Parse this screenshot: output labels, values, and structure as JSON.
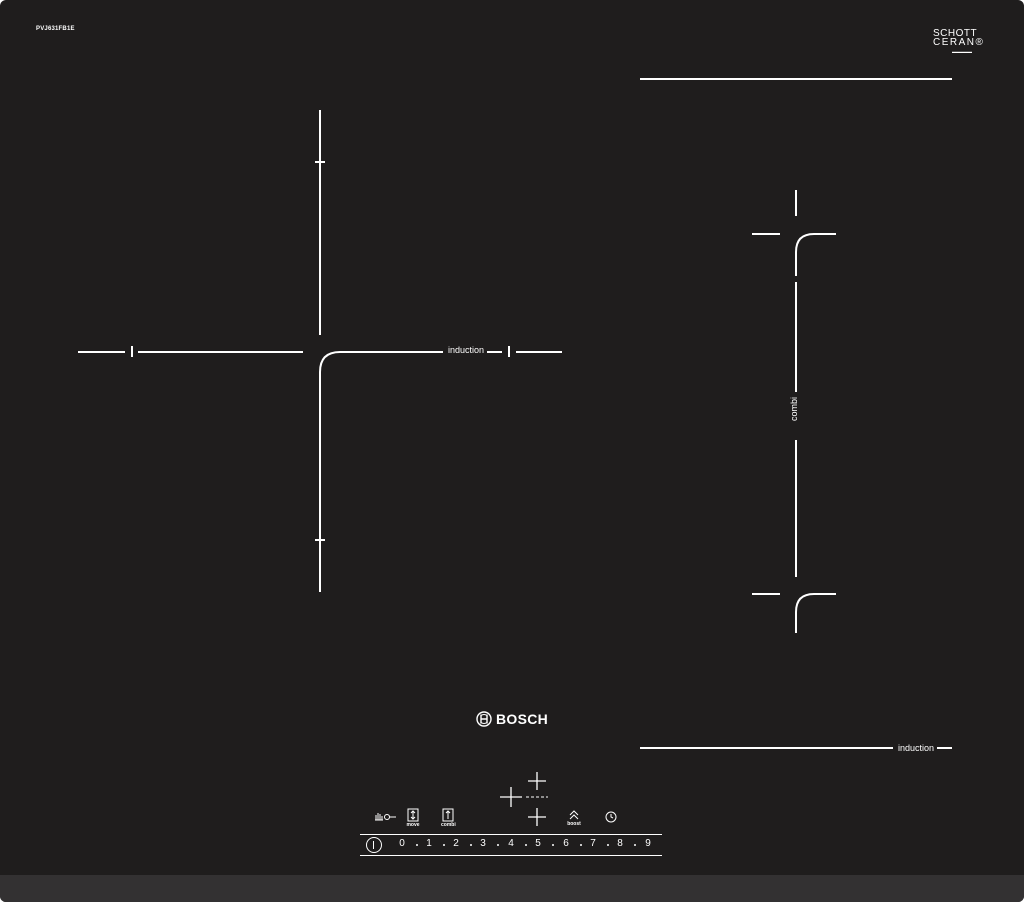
{
  "cooktop": {
    "model_number": "PVJ631FB1E",
    "glass_brand": {
      "line1": "SCHOTT",
      "line2": "CERAN®"
    },
    "zones": {
      "left_label": "induction",
      "right_label": "combi",
      "bottom_label": "induction"
    },
    "brand": {
      "name": "BOSCH",
      "logo_icon": "bosch-armature-icon"
    },
    "controls": {
      "childlock_icon": "hand-key-icon",
      "move_label": "move",
      "move_icon": "move-zones-icon",
      "combi_label": "combi",
      "combi_icon": "combi-zone-icon",
      "boost_label": "boost",
      "boost_icon": "double-chevron-up-icon",
      "timer_icon": "clock-icon",
      "power_icon": "power-icon",
      "zone_select_icons": [
        "zone-select-rear-icon",
        "zone-select-left-icon",
        "zone-select-front-icon"
      ]
    },
    "power_levels": [
      "0",
      "1",
      "2",
      "3",
      "4",
      "5",
      "6",
      "7",
      "8",
      "9"
    ],
    "colors": {
      "glass": "#1f1d1d",
      "frame_edge": "#333132",
      "markings": "#ffffff"
    }
  }
}
